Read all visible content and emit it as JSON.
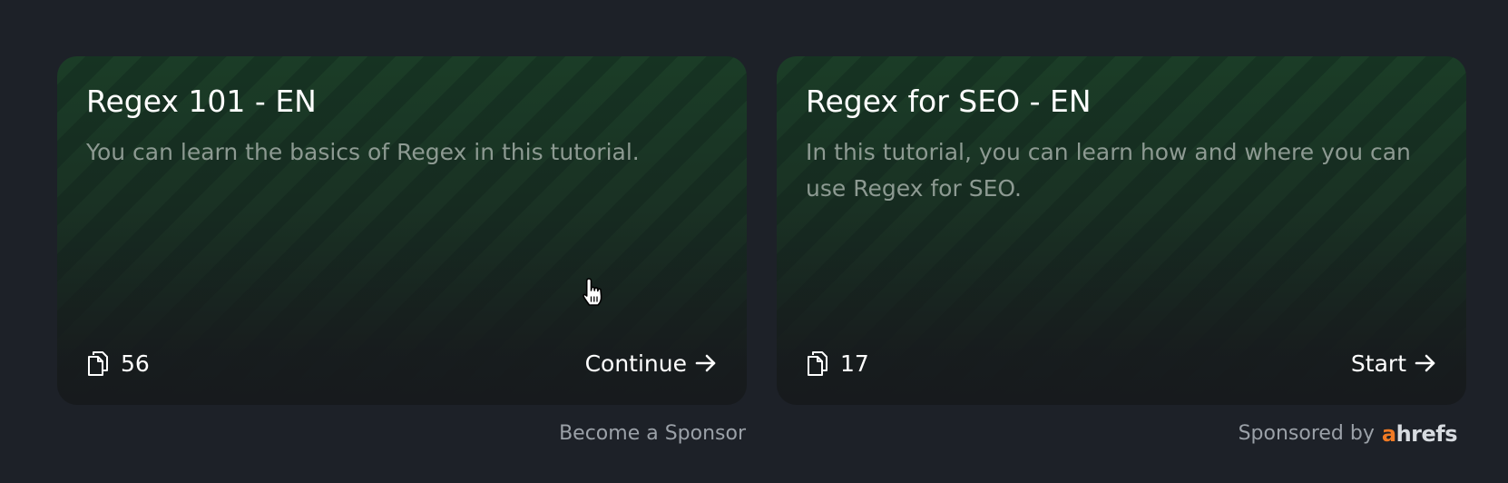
{
  "cards": [
    {
      "title": "Regex 101 - EN",
      "description": "You can learn the basics of Regex in this tutorial.",
      "count": "56",
      "action": "Continue",
      "icon": "pages-icon"
    },
    {
      "title": "Regex for SEO - EN",
      "description": "In this tutorial, you can learn how and where you can use Regex for SEO.",
      "count": "17",
      "action": "Start",
      "icon": "pages-icon"
    }
  ],
  "footer": {
    "become_sponsor": "Become a Sponsor",
    "sponsored_by": "Sponsored by",
    "brand_first": "a",
    "brand_rest": "hrefs"
  },
  "colors": {
    "background": "#1d2128",
    "card_stripe_a": "#1b3d27",
    "card_stripe_b": "#163322",
    "description_text": "#8d9a92",
    "brand_accent": "#f07a24"
  }
}
